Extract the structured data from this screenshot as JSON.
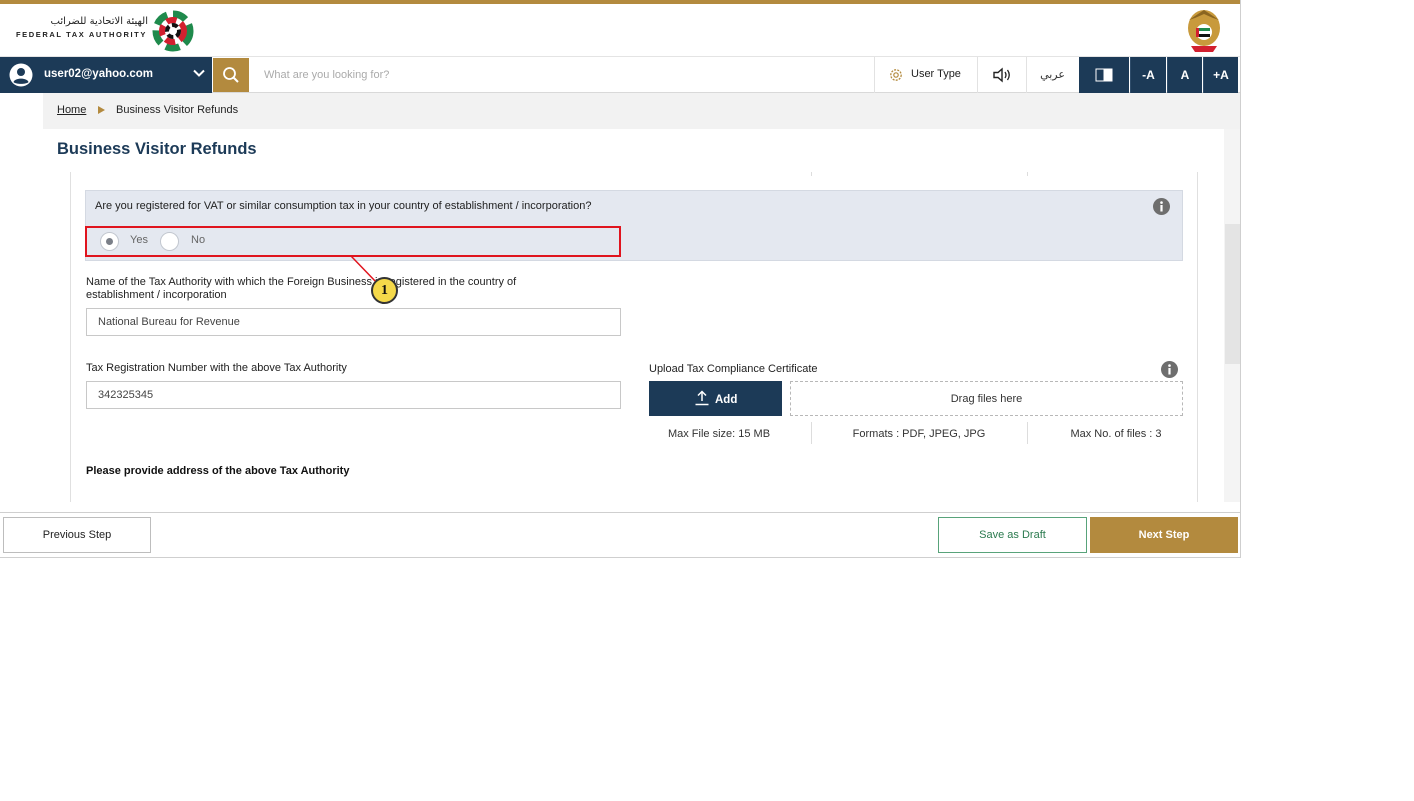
{
  "header": {
    "logo_arabic": "الهيئة الاتحادية للضرائب",
    "logo_english": "FEDERAL TAX AUTHORITY"
  },
  "nav": {
    "user_email": "user02@yahoo.com",
    "search_placeholder": "What are you looking for?",
    "user_type_label": "User Type",
    "language_label": "عربي",
    "font_decrease": "-A",
    "font_normal": "A",
    "font_increase": "+A"
  },
  "breadcrumb": {
    "home": "Home",
    "current": "Business Visitor Refunds"
  },
  "page_title": "Business Visitor Refunds",
  "form": {
    "vat_question": "Are you registered for VAT or similar consumption tax in your country of establishment / incorporation?",
    "options": [
      "Yes",
      "No"
    ],
    "selected_option": "Yes",
    "tax_authority_label_line1": "Name of the Tax Authority with which the Foreign Business is registered in the country of",
    "tax_authority_label_line2": "establishment / incorporation",
    "tax_authority_value": "National Bureau for Revenue",
    "trn_label": "Tax Registration Number with the above Tax Authority",
    "trn_value": "342325345",
    "upload_label": "Upload Tax Compliance Certificate",
    "add_button": "Add",
    "dropzone_text": "Drag files here",
    "max_file_size": "Max File size: 15 MB",
    "formats": "Formats : PDF, JPEG, JPG",
    "max_files": "Max No. of files : 3",
    "address_heading": "Please provide address of the above Tax Authority"
  },
  "annotation": {
    "callout_number": "1"
  },
  "footer": {
    "previous": "Previous Step",
    "save_draft": "Save as Draft",
    "next": "Next Step"
  },
  "colors": {
    "navy": "#1c3a57",
    "gold": "#b38a3e",
    "highlight_red": "#e0141e",
    "draft_green": "#2a7a4e",
    "question_panel": "#e4e8f0"
  }
}
